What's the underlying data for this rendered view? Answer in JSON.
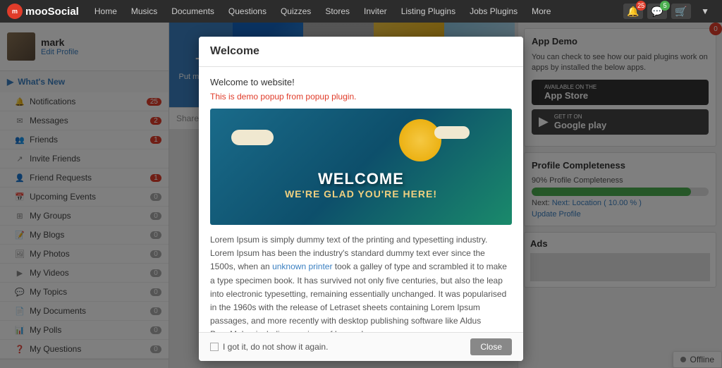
{
  "nav": {
    "logo_text": "mooSocial",
    "items": [
      "Home",
      "Musics",
      "Documents",
      "Questions",
      "Quizzes",
      "Stores",
      "Inviter",
      "Listing Plugins",
      "Jobs Plugins",
      "More"
    ],
    "badge_25": "25",
    "badge_5": "5"
  },
  "sidebar": {
    "username": "mark",
    "edit_profile": "Edit Profile",
    "section_header": "What's New",
    "nav_items": [
      {
        "label": "Notifications",
        "count": "25"
      },
      {
        "label": "Messages",
        "count": "2"
      },
      {
        "label": "Friends",
        "count": "1"
      },
      {
        "label": "Invite Friends",
        "count": ""
      },
      {
        "label": "Friend Requests",
        "count": "1"
      },
      {
        "label": "Upcoming Events",
        "count": "0"
      },
      {
        "label": "My Groups",
        "count": "0"
      },
      {
        "label": "My Blogs",
        "count": "0"
      },
      {
        "label": "My Photos",
        "count": "0"
      },
      {
        "label": "My Videos",
        "count": "0"
      },
      {
        "label": "My Topics",
        "count": "0"
      },
      {
        "label": "My Documents",
        "count": "0"
      },
      {
        "label": "My Polls",
        "count": "0"
      },
      {
        "label": "My Questions",
        "count": "0"
      }
    ]
  },
  "banner": {
    "add_text": "Put me here!"
  },
  "right_panel": {
    "app_demo_title": "App Demo",
    "app_demo_text": "You can check to see how our paid plugins work on apps by installed the below apps.",
    "app_store_label_small": "Available on the",
    "app_store_label_big": "App Store",
    "google_play_label_small": "GET IT ON",
    "google_play_label_big": "Google play",
    "profile_title": "Profile Completeness",
    "profile_percent_label": "90% Profile Completeness",
    "profile_percent": 90,
    "profile_next": "Next: Location ( 10.00 % )",
    "profile_update": "Update Profile",
    "ads_title": "Ads",
    "offline_label": "Offline"
  },
  "modal": {
    "title": "Welcome",
    "subtitle": "Welcome to website!",
    "demo_text": "This is demo popup from popup plugin.",
    "banner_text1": "WELCOME",
    "banner_text2": "WE'RE GLAD YOU'RE HERE!",
    "lorem_text": "Lorem Ipsum is simply dummy text of the printing and typesetting industry. Lorem Ipsum has been the industry's standard dummy text ever since the 1500s, when an unknown printer took a galley of type and scrambled it to make a type specimen book. It has survived not only five centuries, but also the leap into electronic typesetting, remaining essentially unchanged. It was popularised in the 1960s with the release of Letraset sheets containing Lorem Ipsum passages, and more recently with desktop publishing software like Aldus PageMaker including versions of Lorem Ipsum.",
    "checkbox_label": "I got it, do not show it again.",
    "close_button": "Close"
  },
  "share_bar": {
    "placeholder": "Share what's new"
  }
}
